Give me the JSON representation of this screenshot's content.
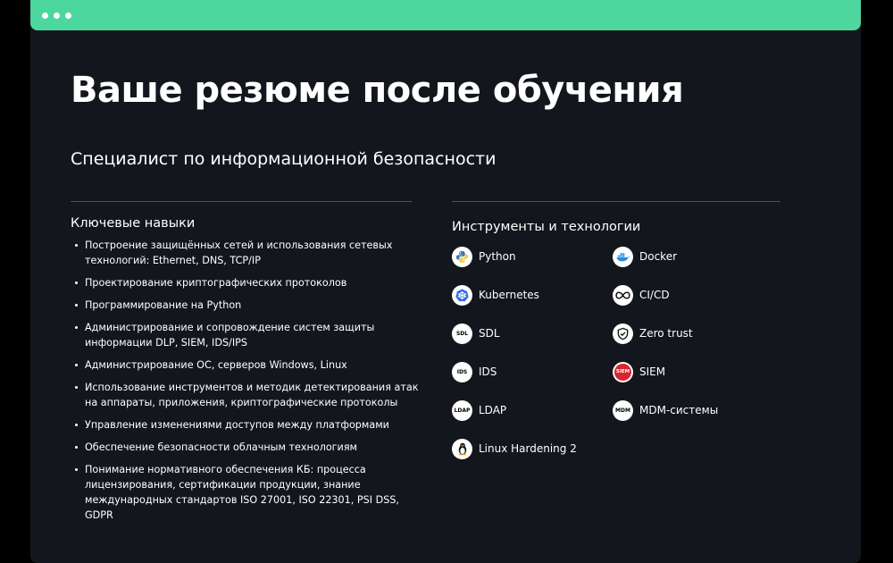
{
  "window": {
    "dots": 3
  },
  "header": {
    "title": "Ваше резюме после обучения",
    "subtitle": "Специалист по информационной безопасности"
  },
  "skills": {
    "title": "Ключевые навыки",
    "items": [
      "Построение защищённых сетей и использования сетевых технологий: Ethernet, DNS, TCP/IP",
      "Проектирование криптографических протоколов",
      "Программирование на Python",
      "Администрирование и сопровождение систем защиты информации DLP, SIEM, IDS/IPS",
      "Администрирование ОС, серверов Windows, Linux",
      "Использование инструментов и методик детектирования атак на аппараты, приложения, криптографические протоколы",
      "Управление изменениями доступов между платформами",
      "Обеспечение безопасности облачным технологиям",
      "Понимание нормативного обеспечения КБ: процесса лицензирования, сертификации продукции, знание международных стандартов ISO 27001, ISO 22301, PSI DSS, GDPR"
    ]
  },
  "tools": {
    "title": "Инструменты и технологии",
    "items": [
      {
        "label": "Python",
        "icon": "python-icon",
        "icon_text": ""
      },
      {
        "label": "Docker",
        "icon": "docker-icon",
        "icon_text": ""
      },
      {
        "label": "Kubernetes",
        "icon": "kubernetes-icon",
        "icon_text": ""
      },
      {
        "label": "CI/CD",
        "icon": "ci-cd-icon",
        "icon_text": ""
      },
      {
        "label": "SDL",
        "icon": "sdl-icon",
        "icon_text": "SDL"
      },
      {
        "label": "Zero trust",
        "icon": "shield-check-icon",
        "icon_text": ""
      },
      {
        "label": "IDS",
        "icon": "ids-icon",
        "icon_text": "IDS"
      },
      {
        "label": "SIEM",
        "icon": "siem-icon",
        "icon_text": "SIEM"
      },
      {
        "label": "LDAP",
        "icon": "ldap-icon",
        "icon_text": "LDAP"
      },
      {
        "label": "MDM-системы",
        "icon": "mdm-icon",
        "icon_text": "MDM"
      },
      {
        "label": "Linux Hardening 2",
        "icon": "linux-tux-icon",
        "icon_text": ""
      }
    ]
  },
  "colors": {
    "accent": "#4dd69e",
    "background": "#13171d",
    "page": "#000000",
    "text": "#ffffff",
    "divider": "#4a4f57"
  }
}
